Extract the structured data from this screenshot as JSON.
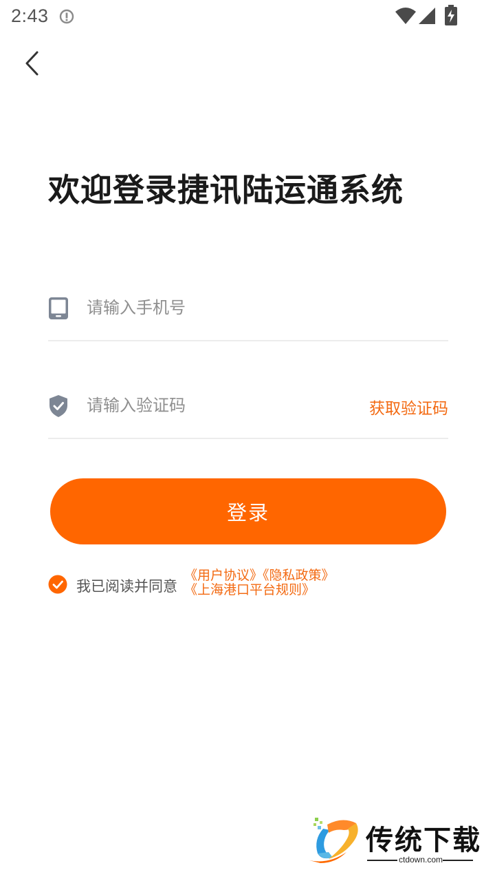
{
  "status_bar": {
    "time": "2:43",
    "icons": [
      "info-icon",
      "wifi-icon",
      "signal-icon",
      "battery-charging-icon"
    ]
  },
  "nav": {
    "back_icon": "chevron-left-icon"
  },
  "title": "欢迎登录捷讯陆运通系统",
  "form": {
    "phone": {
      "icon": "tablet-icon",
      "placeholder": "请输入手机号",
      "value": ""
    },
    "code": {
      "icon": "shield-check-icon",
      "placeholder": "请输入验证码",
      "value": "",
      "get_code_label": "获取验证码"
    }
  },
  "login_button_label": "登录",
  "agreement": {
    "checked": true,
    "prefix": "我已阅读并同意",
    "links": [
      "《用户协议》",
      "《隐私政策》",
      "《上海港口平台规则》"
    ]
  },
  "watermark": {
    "brand": "传统下载",
    "domain": "ctdown.com"
  },
  "colors": {
    "accent": "#ff6600",
    "link": "#f36a12",
    "icon_gray": "#7d8694",
    "title": "#1a1a1a",
    "divider": "#ececec"
  }
}
